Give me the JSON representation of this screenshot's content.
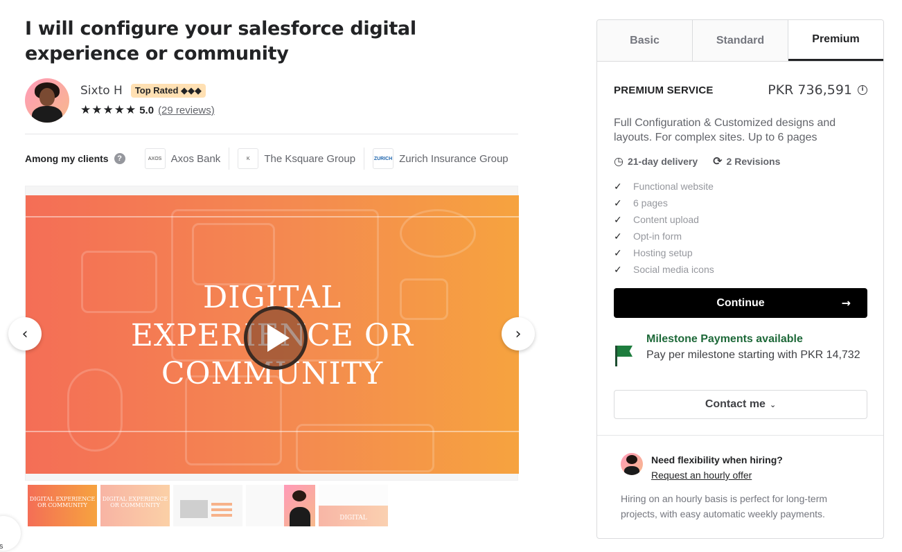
{
  "gig": {
    "title": "I will configure your salesforce digital experience or community"
  },
  "seller": {
    "name": "Sixto H",
    "badge": "Top Rated ◆◆◆",
    "stars": "★★★★★",
    "rating": "5.0",
    "reviews": "(29 reviews)"
  },
  "clients": {
    "label": "Among my clients",
    "help_icon": "?",
    "items": [
      {
        "name": "Axos Bank",
        "logo": "AXOS"
      },
      {
        "name": "The Ksquare Group",
        "logo": "K"
      },
      {
        "name": "Zurich Insurance Group",
        "logo": "ZURICH"
      }
    ]
  },
  "gallery": {
    "slide_text_line1": "DIGITAL",
    "slide_text_line2": "EXPERIENCE OR",
    "slide_text_line3": "COMMUNITY",
    "prev_arrow": "‹",
    "next_arrow": "›",
    "thumbnails": [
      {
        "text": "DIGITAL EXPERIENCE OR COMMUNITY"
      },
      {
        "text": "DIGITAL EXPERIENCE OR COMMUNITY"
      },
      {
        "text": ""
      },
      {
        "text": ""
      },
      {
        "text": "DIGITAL"
      }
    ]
  },
  "side_tab": {
    "label": "s"
  },
  "package": {
    "tabs": [
      {
        "label": "Basic",
        "active": false
      },
      {
        "label": "Standard",
        "active": false
      },
      {
        "label": "Premium",
        "active": true
      }
    ],
    "name": "PREMIUM SERVICE",
    "price": "PKR 736,591",
    "description": "Full Configuration & Customized designs and layouts. For complex sites. Up to 6 pages",
    "delivery": "21-day delivery",
    "revisions": "2 Revisions",
    "features": [
      "Functional website",
      "6 pages",
      "Content upload",
      "Opt-in form",
      "Hosting setup",
      "Social media icons"
    ],
    "continue_label": "Continue",
    "continue_arrow": "→"
  },
  "milestone": {
    "title": "Milestone Payments available",
    "subtitle": "Pay per milestone starting with PKR 14,732"
  },
  "contact": {
    "label": "Contact me",
    "chevron": "⌄"
  },
  "hourly": {
    "title": "Need flexibility when hiring?",
    "link": "Request an hourly offer",
    "description": "Hiring on an hourly basis is perfect for long-term projects, with easy automatic weekly payments."
  },
  "colors": {
    "accent_green": "#1e6939",
    "badge_bg": "#ffe0b3",
    "button_black": "#000000",
    "slide_gradient_start": "#f46e56",
    "slide_gradient_end": "#f6a33f"
  }
}
